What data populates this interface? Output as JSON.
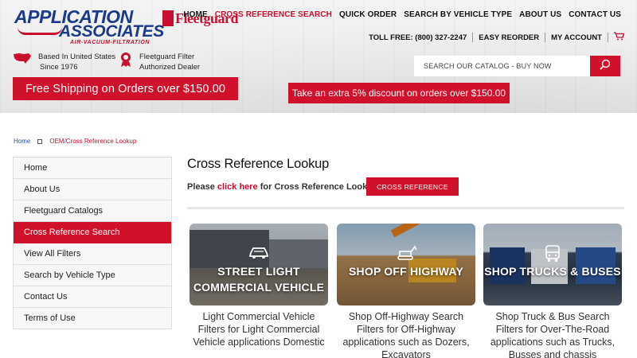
{
  "brand": {
    "logo_line1": "APPLICATION",
    "logo_line2": "ASSOCIATES",
    "logo_tagline": "AIR-VACUUM-FILTRATION",
    "partner_logo": "Fleetguard"
  },
  "nav": {
    "items": [
      {
        "label": "HOME",
        "active": false
      },
      {
        "label": "CROSS REFERENCE SEARCH",
        "active": true
      },
      {
        "label": "QUICK ORDER",
        "active": false
      },
      {
        "label": "SEARCH BY VEHICLE TYPE",
        "active": false
      },
      {
        "label": "ABOUT US",
        "active": false
      },
      {
        "label": "CONTACT US",
        "active": false
      }
    ]
  },
  "utility": {
    "toll_free": "TOLL FREE: (800) 327-2247",
    "easy_reorder": "EASY REORDER",
    "my_account": "MY ACCOUNT",
    "cart_icon": "cart-icon"
  },
  "badges": {
    "usa_line1": "Based In United States",
    "usa_line2": "Since 1976",
    "dealer_line1": "Fleetguard Filter",
    "dealer_line2": "Authorized Dealer"
  },
  "search": {
    "placeholder": "SEARCH OUR CATALOG - BUY NOW",
    "icon": "search-icon"
  },
  "promos": {
    "shipping": "Free Shipping on Orders over $150.00",
    "discount": "Take an extra 5% discount on orders over $150.00"
  },
  "breadcrumb": {
    "home": "Home",
    "current": "OEM/Cross Reference Lookup"
  },
  "sidebar": {
    "items": [
      {
        "label": "Home",
        "active": false
      },
      {
        "label": "About Us",
        "active": false
      },
      {
        "label": "Fleetguard Catalogs",
        "active": false
      },
      {
        "label": "Cross Reference Search",
        "active": true
      },
      {
        "label": "View All Filters",
        "active": false
      },
      {
        "label": "Search by Vehicle Type",
        "active": false
      },
      {
        "label": "Contact Us",
        "active": false
      },
      {
        "label": "Terms of Use",
        "active": false
      }
    ]
  },
  "main": {
    "title": "Cross Reference Lookup",
    "prompt_before": "Please ",
    "prompt_link": "click here",
    "prompt_after": " for Cross Reference Lookup",
    "button": "CROSS REFERENCE"
  },
  "cards": [
    {
      "label_line1": "STREET LIGHT",
      "label_line2": "COMMERCIAL VEHICLE",
      "icon": "car-icon",
      "desc": "Light Commercial Vehicle Filters for Light Commercial Vehicle applications Domestic"
    },
    {
      "label_line1": "SHOP OFF HIGHWAY",
      "label_line2": "",
      "icon": "excavator-icon",
      "desc": "Shop Off-Highway Search Filters for Off-Highway applications such as Dozers, Excavators"
    },
    {
      "label_line1": "SHOP TRUCKS & BUSES",
      "label_line2": "",
      "icon": "bus-icon",
      "desc": "Shop Truck & Bus Search Filters for Over-The-Road applications such as Trucks, Busses and chassis"
    }
  ],
  "colors": {
    "accent": "#d0112b",
    "brand_blue": "#1b3a8c",
    "link_blue": "#1b4d9c"
  }
}
